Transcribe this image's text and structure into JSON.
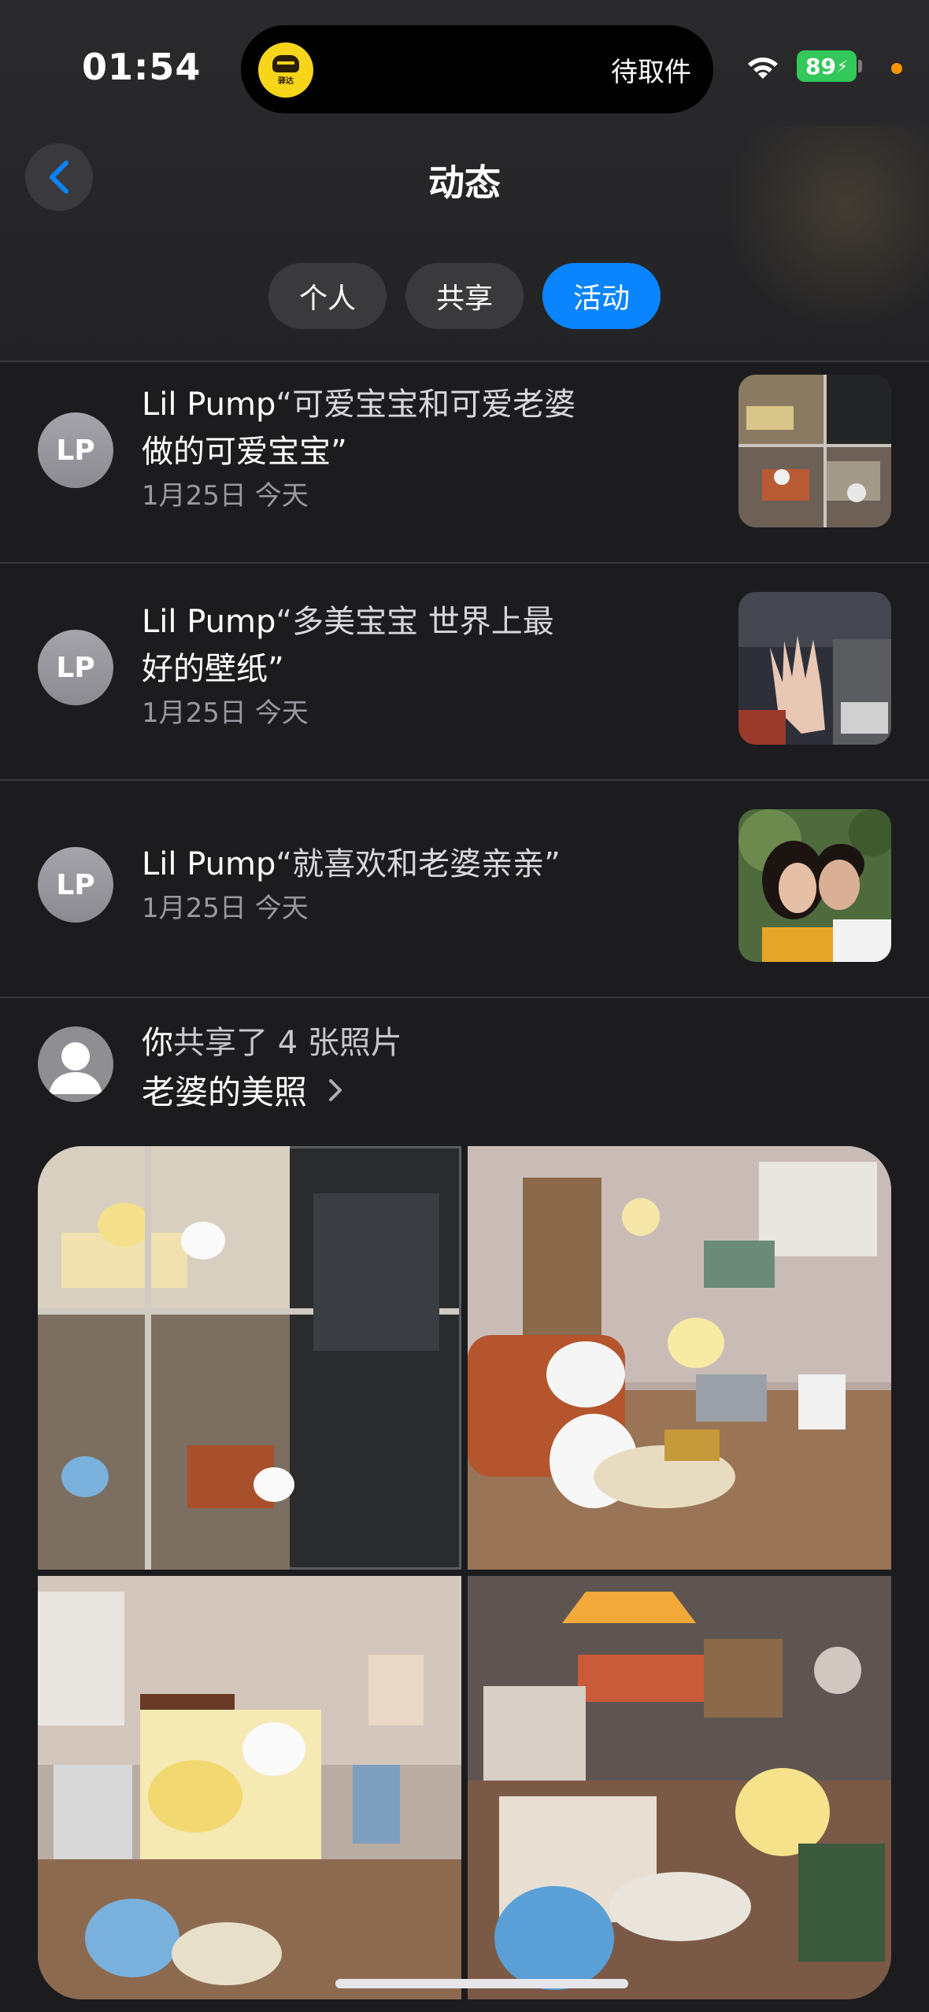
{
  "status_bar": {
    "time": "01:54",
    "island_app_label": "驿达",
    "island_text": "待取件",
    "battery": "89"
  },
  "nav": {
    "title": "动态",
    "back_icon": "chevron-left-icon"
  },
  "tabs": [
    {
      "label": "个人",
      "active": false
    },
    {
      "label": "共享",
      "active": false
    },
    {
      "label": "活动",
      "active": true
    }
  ],
  "activities": [
    {
      "initials": "LP",
      "user": "Lil Pump",
      "line1": "“可爱宝宝和可爱老婆",
      "line2": "做的可爱宝宝”",
      "date": "1月25日 今天"
    },
    {
      "initials": "LP",
      "user": "Lil Pump",
      "line1": "“多美宝宝 世界上最",
      "line2": "好的壁纸”",
      "date": "1月25日 今天"
    },
    {
      "initials": "LP",
      "user": "Lil Pump",
      "line1": "“就喜欢和老婆亲亲”",
      "line2": "",
      "date": "1月25日 今天"
    }
  ],
  "shared": {
    "prefix": "你",
    "action": "共享了 4 张照片",
    "album": "老婆的美照",
    "chevron": "chevron-right-icon"
  },
  "colors": {
    "accent": "#0a84ff",
    "background": "#1c1c1e",
    "battery": "#34c759"
  }
}
